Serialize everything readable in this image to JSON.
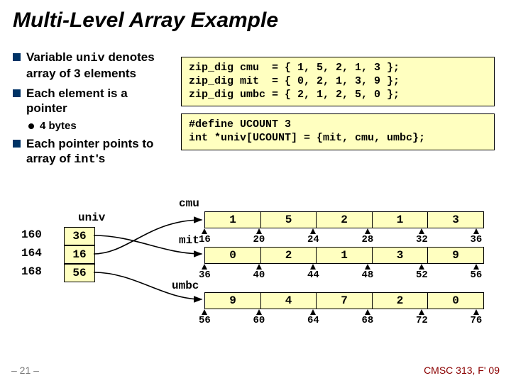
{
  "title": "Multi-Level Array Example",
  "bullets": {
    "b1a": "Variable ",
    "b1b": "univ",
    "b1c": " denotes array of 3 elements",
    "b2": "Each element is a pointer",
    "b2s": "4 bytes",
    "b3a": "Each pointer points to array of ",
    "b3b": "int",
    "b3c": "'s"
  },
  "code1": "zip_dig cmu  = { 1, 5, 2, 1, 3 };\nzip_dig mit  = { 0, 2, 1, 3, 9 };\nzip_dig umbc = { 2, 1, 2, 5, 0 };",
  "code2": "#define UCOUNT 3\nint *univ[UCOUNT] = {mit, cmu, umbc};",
  "diagram": {
    "univ_label": "univ",
    "ptr_addrs": [
      "160",
      "164",
      "168"
    ],
    "ptr_vals": [
      "36",
      "16",
      "56"
    ],
    "arrays": [
      {
        "name": "cmu",
        "vals": [
          "1",
          "5",
          "2",
          "1",
          "3"
        ],
        "addrs": [
          "16",
          "20",
          "24",
          "28",
          "32",
          "36"
        ]
      },
      {
        "name": "mit",
        "vals": [
          "0",
          "2",
          "1",
          "3",
          "9"
        ],
        "addrs": [
          "36",
          "40",
          "44",
          "48",
          "52",
          "56"
        ]
      },
      {
        "name": "umbc",
        "vals": [
          "9",
          "4",
          "7",
          "2",
          "0"
        ],
        "addrs": [
          "56",
          "60",
          "64",
          "68",
          "72",
          "76"
        ]
      }
    ]
  },
  "footer": {
    "left": "– 21 –",
    "right": "CMSC 313, F' 09"
  }
}
